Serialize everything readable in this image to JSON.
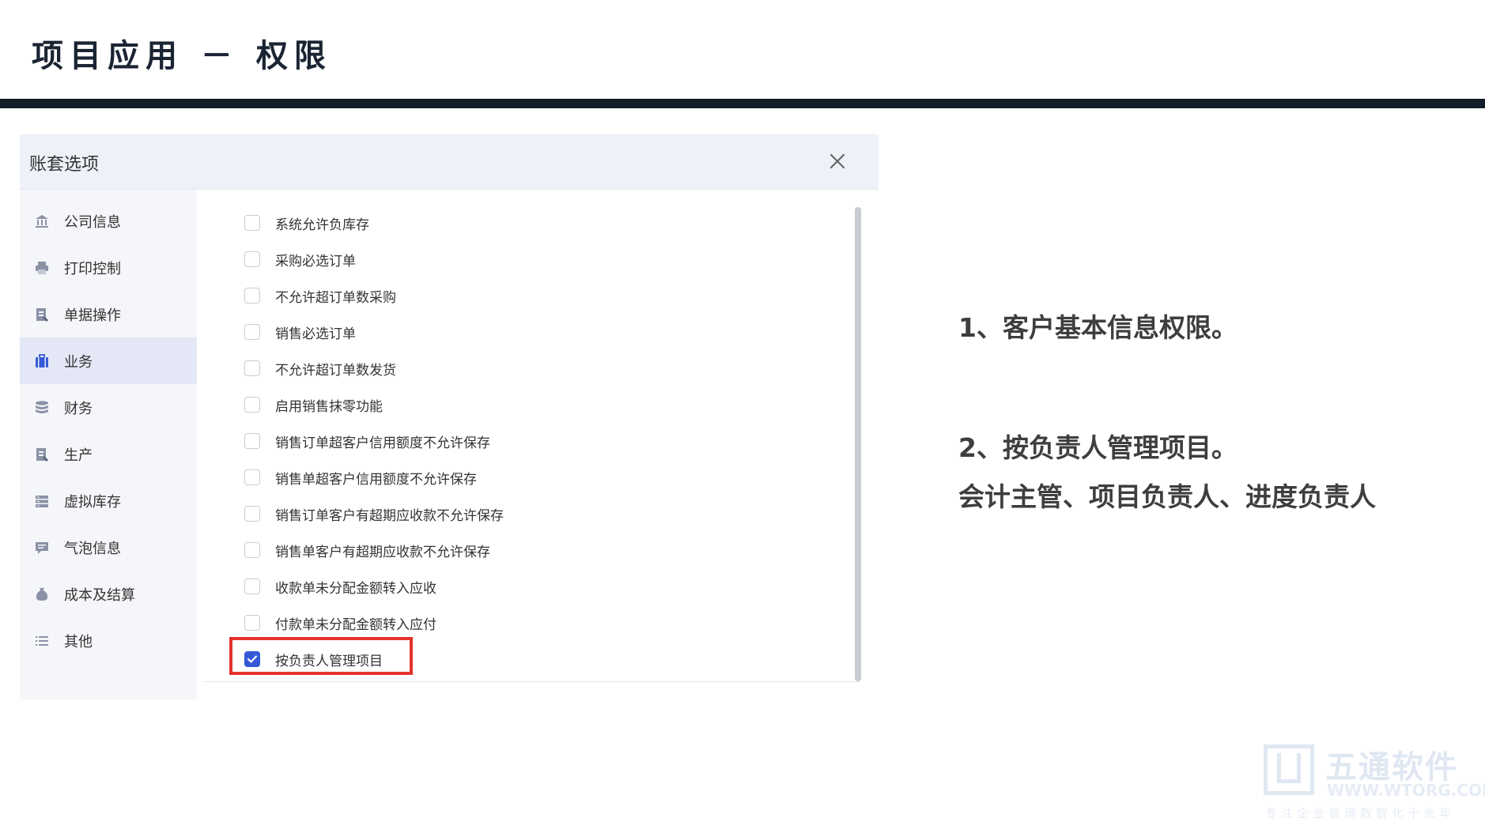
{
  "slide": {
    "title": "项目应用 － 权限"
  },
  "dialog": {
    "title": "账套选项",
    "sidebar": [
      {
        "label": "公司信息",
        "icon": "bank-icon"
      },
      {
        "label": "打印控制",
        "icon": "printer-icon"
      },
      {
        "label": "单据操作",
        "icon": "document-edit-icon"
      },
      {
        "label": "业务",
        "icon": "briefcase-icon",
        "active": true
      },
      {
        "label": "财务",
        "icon": "database-icon"
      },
      {
        "label": "生产",
        "icon": "document-edit-icon"
      },
      {
        "label": "虚拟库存",
        "icon": "storage-icon"
      },
      {
        "label": "气泡信息",
        "icon": "chat-bubble-icon"
      },
      {
        "label": "成本及结算",
        "icon": "money-bag-icon"
      },
      {
        "label": "其他",
        "icon": "list-icon"
      }
    ],
    "options": [
      {
        "label": "系统允许负库存",
        "checked": false
      },
      {
        "label": "采购必选订单",
        "checked": false
      },
      {
        "label": "不允许超订单数采购",
        "checked": false
      },
      {
        "label": "销售必选订单",
        "checked": false
      },
      {
        "label": "不允许超订单数发货",
        "checked": false
      },
      {
        "label": "启用销售抹零功能",
        "checked": false
      },
      {
        "label": "销售订单超客户信用额度不允许保存",
        "checked": false
      },
      {
        "label": "销售单超客户信用额度不允许保存",
        "checked": false
      },
      {
        "label": "销售订单客户有超期应收款不允许保存",
        "checked": false
      },
      {
        "label": "销售单客户有超期应收款不允许保存",
        "checked": false
      },
      {
        "label": "收款单未分配金额转入应收",
        "checked": false
      },
      {
        "label": "付款单未分配金额转入应付",
        "checked": false
      },
      {
        "label": "按负责人管理项目",
        "checked": true
      }
    ]
  },
  "notes": {
    "line1": "1、客户基本信息权限。",
    "line2": "2、按负责人管理项目。",
    "line3": "会计主管、项目负责人、进度负责人"
  },
  "watermark": {
    "name": "五通软件",
    "url": "WWW.WTORG.COM",
    "slogan": "专注企业管理数智化十余年"
  },
  "colors": {
    "accent": "#3559d6",
    "highlight": "#e5322d",
    "title_bar": "#131c29"
  }
}
